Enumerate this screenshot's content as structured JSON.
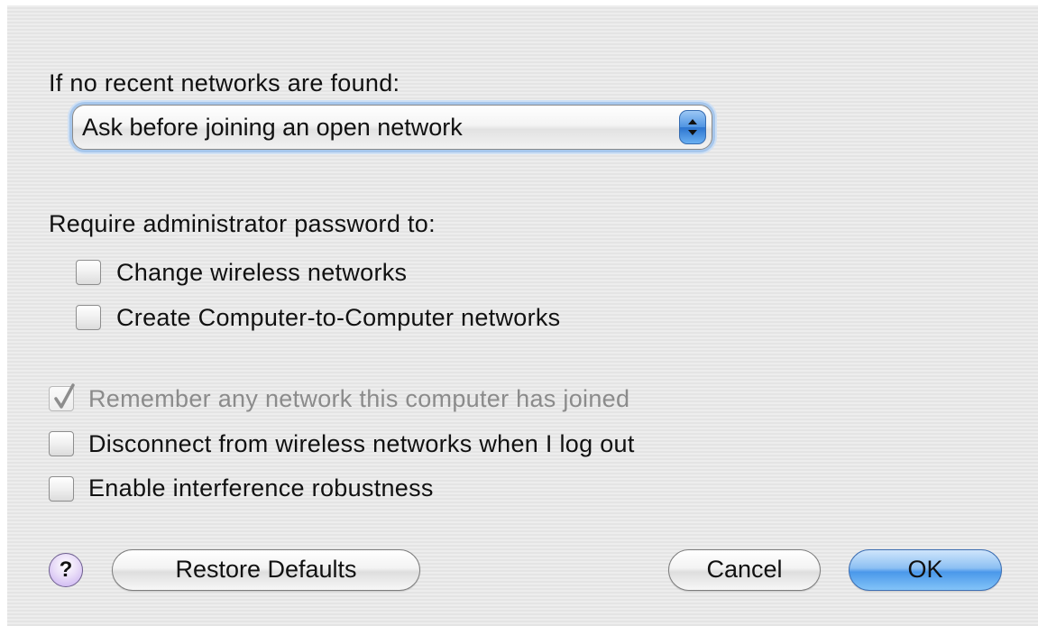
{
  "recent_networks": {
    "label": "If no recent networks are found:",
    "popup_value": "Ask before joining an open network"
  },
  "admin": {
    "label": "Require administrator password to:",
    "options": [
      {
        "label": "Change wireless networks",
        "checked": false
      },
      {
        "label": "Create Computer-to-Computer networks",
        "checked": false
      }
    ]
  },
  "general_options": [
    {
      "label": "Remember any network this computer has joined",
      "checked": true,
      "enabled": false
    },
    {
      "label": "Disconnect from wireless networks when I log out",
      "checked": false,
      "enabled": true
    },
    {
      "label": "Enable interference robustness",
      "checked": false,
      "enabled": true
    }
  ],
  "buttons": {
    "help": "?",
    "restore_defaults": "Restore Defaults",
    "cancel": "Cancel",
    "ok": "OK"
  },
  "colors": {
    "default_button": "#4a98ea",
    "help_button": "#c6acf0",
    "focus_ring": "#a7c7ec"
  }
}
